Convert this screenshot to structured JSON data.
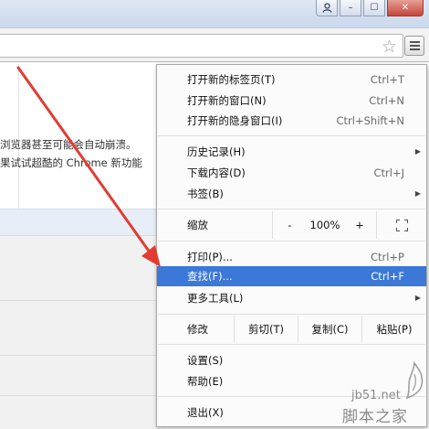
{
  "window": {
    "user_icon": "user-icon",
    "minimize_glyph": "–",
    "maximize_glyph": "☐",
    "close_glyph": "✕"
  },
  "toolbar": {
    "star_glyph": "☆"
  },
  "page": {
    "line1": "浏览器甚至可能会自动崩溃。",
    "line2": "果试试超酷的 Chrome 新功能"
  },
  "menu": {
    "items": [
      {
        "label": "打开新的标签页(T)",
        "shortcut": "Ctrl+T"
      },
      {
        "label": "打开新的窗口(N)",
        "shortcut": "Ctrl+N"
      },
      {
        "label": "打开新的隐身窗口(I)",
        "shortcut": "Ctrl+Shift+N"
      },
      {
        "label": "历史记录(H)",
        "shortcut": ""
      },
      {
        "label": "下载内容(D)",
        "shortcut": "Ctrl+J"
      },
      {
        "label": "书签(B)",
        "shortcut": ""
      },
      {
        "label": "打印(P)...",
        "shortcut": "Ctrl+P"
      },
      {
        "label": "查找(F)...",
        "shortcut": "Ctrl+F"
      },
      {
        "label": "更多工具(L)",
        "shortcut": ""
      },
      {
        "label": "设置(S)",
        "shortcut": ""
      },
      {
        "label": "帮助(E)",
        "shortcut": ""
      },
      {
        "label": "退出(X)",
        "shortcut": ""
      }
    ],
    "zoom": {
      "label": "缩放",
      "minus": "-",
      "value": "100%",
      "plus": "+"
    },
    "edit": {
      "label": "修改",
      "cut": "剪切(T)",
      "copy": "复制(C)",
      "paste": "粘贴(P)"
    }
  },
  "watermark": {
    "site": "jb51.net",
    "name": "脚本之家"
  },
  "colors": {
    "highlight": "#3b78d7",
    "arrow": "#e23b33"
  }
}
